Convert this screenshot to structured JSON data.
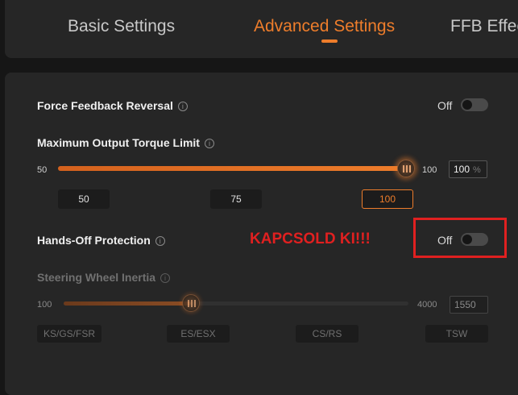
{
  "tabs": [
    {
      "label": "Basic Settings",
      "active": false
    },
    {
      "label": "Advanced Settings",
      "active": true
    },
    {
      "label": "FFB Effects",
      "active": false
    }
  ],
  "colors": {
    "accent": "#ee7d2b",
    "annotation": "#e02020",
    "panel": "#262626"
  },
  "force_feedback_reversal": {
    "label": "Force Feedback Reversal",
    "state": "Off"
  },
  "max_torque": {
    "label": "Maximum Output Torque Limit",
    "min": "50",
    "max": "100",
    "value": "100",
    "unit": "%",
    "level_fraction": 1.0,
    "presets": [
      "50",
      "75",
      "100"
    ],
    "selected_preset": "100"
  },
  "hands_off": {
    "label": "Hands-Off Protection",
    "state": "Off"
  },
  "annotation": {
    "text": "KAPCSOLD KI!!!"
  },
  "steering_inertia": {
    "label": "Steering Wheel Inertia",
    "min": "100",
    "max": "4000",
    "value": "1550",
    "level_fraction": 0.37,
    "presets": [
      "KS/GS/FSR",
      "ES/ESX",
      "CS/RS",
      "TSW"
    ]
  },
  "icons": {
    "info": "info-icon",
    "toggle": "toggle-switch",
    "slider_thumb": "slider-thumb"
  }
}
